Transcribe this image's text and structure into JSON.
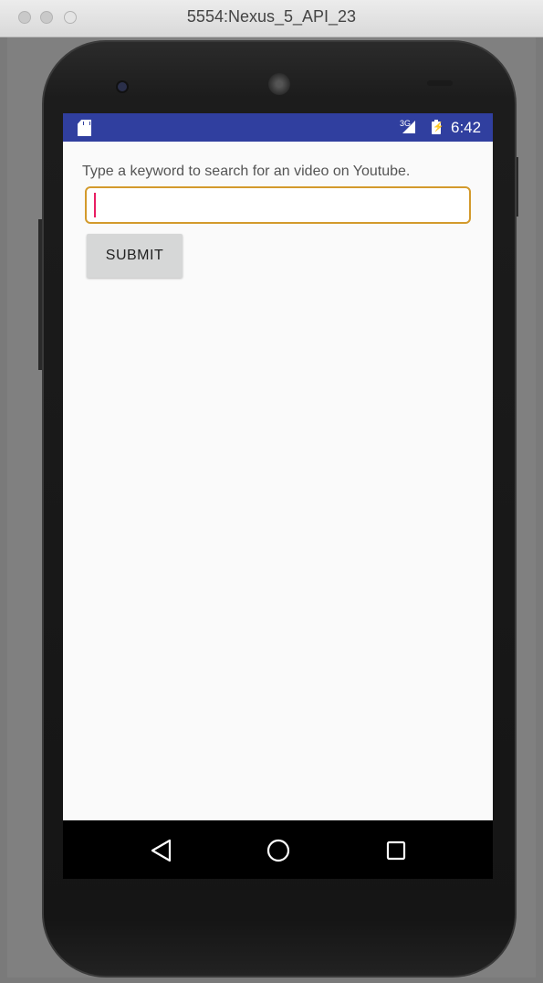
{
  "window": {
    "title": "5554:Nexus_5_API_23"
  },
  "statusbar": {
    "network": "3G",
    "time": "6:42",
    "background": "#303f9f"
  },
  "main": {
    "prompt": "Type a keyword to search for an video on Youtube.",
    "search": {
      "value": "",
      "placeholder": ""
    },
    "submit_label": "SUBMIT"
  },
  "navbar": {
    "back_icon": "back-triangle-icon",
    "home_icon": "home-circle-icon",
    "recent_icon": "recent-apps-square-icon"
  },
  "colors": {
    "accent": "#e91e63",
    "input_border": "#d39a2c"
  }
}
